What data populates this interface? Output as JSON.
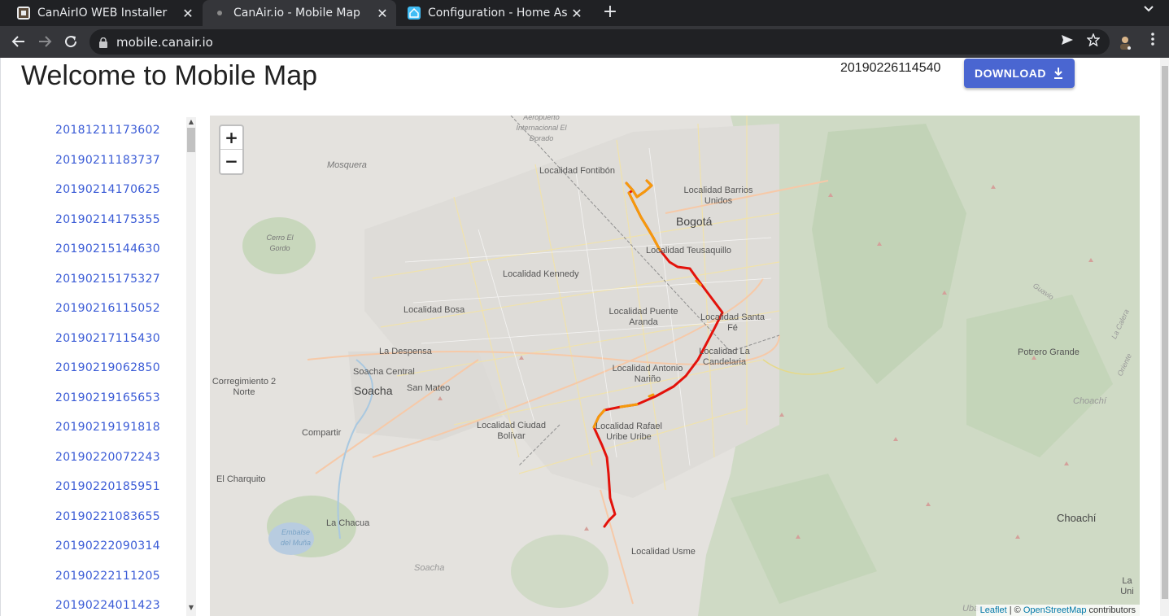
{
  "browser": {
    "tabs": [
      {
        "title": "CanAirIO WEB Installer",
        "active": false
      },
      {
        "title": "CanAir.io - Mobile Map",
        "active": true
      },
      {
        "title": "Configuration - Home Assis",
        "active": false
      }
    ],
    "url": "mobile.canair.io"
  },
  "header": {
    "title": "Welcome to Mobile Map",
    "selected_session": "20190226114540",
    "download_label": "DOWNLOAD"
  },
  "sessions": [
    "20181211173602",
    "20190211183737",
    "20190214170625",
    "20190214175355",
    "20190215144630",
    "20190215175327",
    "20190216115052",
    "20190217115430",
    "20190219062850",
    "20190219165653",
    "20190219191818",
    "20190220072243",
    "20190220185951",
    "20190221083655",
    "20190222090314",
    "20190222111205",
    "20190224011423"
  ],
  "map": {
    "zoom_in": "+",
    "zoom_out": "−",
    "attribution_leaflet": "Leaflet",
    "attribution_sep": " | © ",
    "attribution_osm": "OpenStreetMap",
    "attribution_tail": " contributors",
    "labels": {
      "fontibon": "Localidad Fontibón",
      "barrios_unidos": "Localidad Barrios Unidos",
      "bogota": "Bogotá",
      "teusaquillo": "Localidad Teusaquillo",
      "kennedy": "Localidad Kennedy",
      "bosa": "Localidad Bosa",
      "puente_aranda": "Localidad Puente Aranda",
      "santa_fe": "Localidad Santa Fé",
      "candelaria": "Localidad La Candelaria",
      "despensa": "La Despensa",
      "soacha_central": "Soacha Central",
      "soacha": "Soacha",
      "san_mateo": "San Mateo",
      "antonio_narino": "Localidad Antonio Nariño",
      "ciudad_bolivar": "Localidad Ciudad Bolívar",
      "rafael_uribe": "Localidad Rafael Uribe Uribe",
      "corregimiento": "Corregimiento 2 Norte",
      "compartir": "Compartir",
      "el_charquito": "El Charquito",
      "la_chacua": "La Chacua",
      "usme": "Localidad Usme",
      "mosquera": "Mosquera",
      "cerro_gordo": "Cerro El Gordo",
      "aeropuerto": "Aeropuerto Internacional El Dorado",
      "potrero_grande": "Potrero Grande",
      "choachi": "Choachí",
      "choachi_small": "Choachí",
      "embalse": "Embalse del Muña",
      "soacha_small": "Soacha",
      "ubaque": "Ubaque",
      "la_union": "La Uni",
      "guavio": "Guavio",
      "la_calera": "La Calera",
      "oriente": "Oriente"
    },
    "route_colors": {
      "high": "#e3120b",
      "medium": "#f59a0c"
    }
  }
}
